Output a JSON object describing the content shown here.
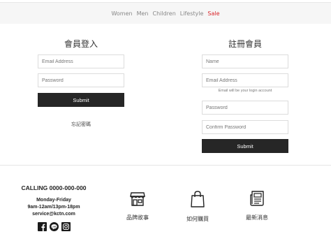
{
  "nav": {
    "items": [
      {
        "label": "Women"
      },
      {
        "label": "Men"
      },
      {
        "label": "Children"
      },
      {
        "label": "Lifestyle"
      },
      {
        "label": "Sale"
      }
    ],
    "sale_color": "#d9252a"
  },
  "login": {
    "title": "會員登入",
    "email_placeholder": "Email Address",
    "password_placeholder": "Password",
    "submit_label": "Submit",
    "forgot_label": "忘記密碼"
  },
  "register": {
    "title": "註冊會員",
    "name_placeholder": "Name",
    "email_placeholder": "Email Address",
    "email_hint": "Email will be your login account",
    "password_placeholder": "Password",
    "confirm_placeholder": "Confirm Password",
    "submit_label": "Submit"
  },
  "footer": {
    "calling": "CALLING 0000-000-000",
    "hours_days": "Monday-Friday",
    "hours_times": "9am-12am/13pm-18pm",
    "email": "service@kctn.com",
    "social_icons": [
      "facebook-icon",
      "line-icon",
      "instagram-icon"
    ],
    "features": [
      {
        "label": "品牌故事",
        "icon": "storefront-icon"
      },
      {
        "label": "如何購買",
        "icon": "shopping-bag-icon"
      },
      {
        "label": "最新消息",
        "icon": "newspaper-icon"
      }
    ]
  },
  "colors": {
    "button": "#262626",
    "nav_background": "#f6f6f6",
    "sale": "#d9252a"
  }
}
